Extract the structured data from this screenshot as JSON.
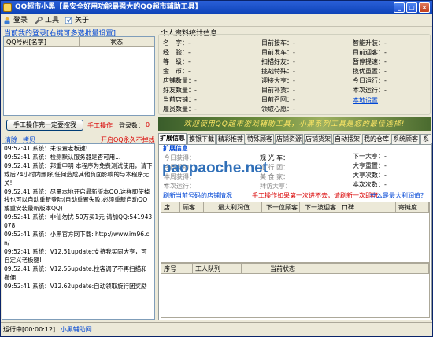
{
  "window": {
    "title": "QQ超市小黑【最安全好用功能最强大的QQ超市辅助工具】",
    "min": "_",
    "max": "□",
    "close": "×"
  },
  "menu": [
    {
      "label": "登录"
    },
    {
      "label": "工具"
    },
    {
      "label": "关于"
    }
  ],
  "login_group": {
    "title": "当前我的登录[右键可多选批量设置]",
    "col_qq": "QQ号码[名字]",
    "col_status": "状态"
  },
  "manual": {
    "button": "手工操作完一定要按我",
    "label": "手工操作",
    "count_label": "登录数：",
    "count": "0"
  },
  "log_toolbar": {
    "clear": "清除",
    "copy": "拷贝",
    "tip": "开启QQ永久不掉线"
  },
  "log": [
    "09:52:41 系统：未设置老板键!",
    "09:52:41 系统：检测默认服务器是否可用...",
    "09:52:41 系统：邦重申明 本程序为免费测试使用，请下载后24小时内删除,任何造成其他负面影响的与本程序无关!",
    "09:52:41 系统：尽量本地开启最新版本QQ,这样即使掉线也可以自动重新登陆(自动重置失败,必须重新启动QQ或重安装最新版本QQ)",
    "09:52:41 系统：非仙勿扰 50万买1元 请加QQ:541943078",
    "09:52:41 系统：小黑官方网下载: http://www.im96.cn/",
    "09:52:41 系统：V12.51update:支持我买同大亨，可自定义老板键!",
    "09:52:41 系统：V12.56update:拉客调了不再扫描和撤佣",
    "09:52:41 系统：V12.62update:自动领取旋行团奖励"
  ],
  "info": {
    "title": "个人资料统计信息",
    "col1": [
      [
        "名　字：",
        "-"
      ],
      [
        "经　验：",
        "-"
      ],
      [
        "等　级：",
        "-"
      ],
      [
        "金　币：",
        "-"
      ],
      [
        "店铺数量：",
        "-"
      ],
      [
        "好友数量：",
        "-"
      ],
      [
        "当前店铺：",
        "-"
      ],
      [
        "雇员数量：",
        "-"
      ]
    ],
    "col2": [
      [
        "目前接车：",
        "-"
      ],
      [
        "目前发车：",
        "-"
      ],
      [
        "扫描好友：",
        "-"
      ],
      [
        "挑战特殊：",
        "-"
      ],
      [
        "迎接大亨：",
        "-"
      ],
      [
        "目前补货：",
        "-"
      ],
      [
        "目前召回：",
        "-"
      ],
      [
        "领取心愿：",
        "-"
      ]
    ],
    "col3": [
      [
        "智能升装：",
        "-"
      ],
      [
        "目前迎客：",
        "-"
      ],
      [
        "暂停提速：",
        "-"
      ],
      [
        "揽优重置：",
        "-"
      ],
      [
        "今日运行：",
        "-"
      ],
      [
        "本次运行：",
        "-"
      ]
    ],
    "settings_link": "本地设置"
  },
  "banner": "欢迎使用QQ超市游戏辅助工具，小黑系列工具是您的最佳选择!",
  "tabs": [
    "扩展信息",
    "摸银下载",
    "精彩推荐",
    "特殊顾客",
    "店铺资源",
    "店铺货架",
    "自动摆架",
    "我的仓库",
    "系统顾客",
    "系"
  ],
  "ext": {
    "header": "扩展信息",
    "rows_left": [
      "今日获得：",
      "今日帮助：",
      "本周获得：",
      "本次运行："
    ],
    "rows_mid": [
      "观 光 车：",
      "旅 行 团：",
      "美 食 家：",
      "拜访大亨："
    ],
    "rows_right": [
      [
        "下一大亨：",
        "-"
      ],
      [
        "大亨重置：",
        "-"
      ],
      [
        "大亨次数：",
        "-"
      ],
      [
        "本次次数：",
        "-"
      ]
    ],
    "watermark": "paopaoche.net",
    "watermark_dash": "-",
    "refresh": "刷新当前号码的店铺情况",
    "manual_tip": "手工操作如果第一次进不去，请刷新一次即可",
    "what_link": "什么是最大利润值？"
  },
  "shop_table": {
    "cols": [
      "店...",
      "顾客...",
      "最大利润值",
      "下一位顾客",
      "下一波迎客",
      "口碑",
      "寄摊度"
    ]
  },
  "staff_table": {
    "cols": [
      "序号",
      "工人队列",
      "当前状态"
    ]
  },
  "status": {
    "running": "运行中[00:00:12]",
    "brand": "小黑辅助网"
  }
}
